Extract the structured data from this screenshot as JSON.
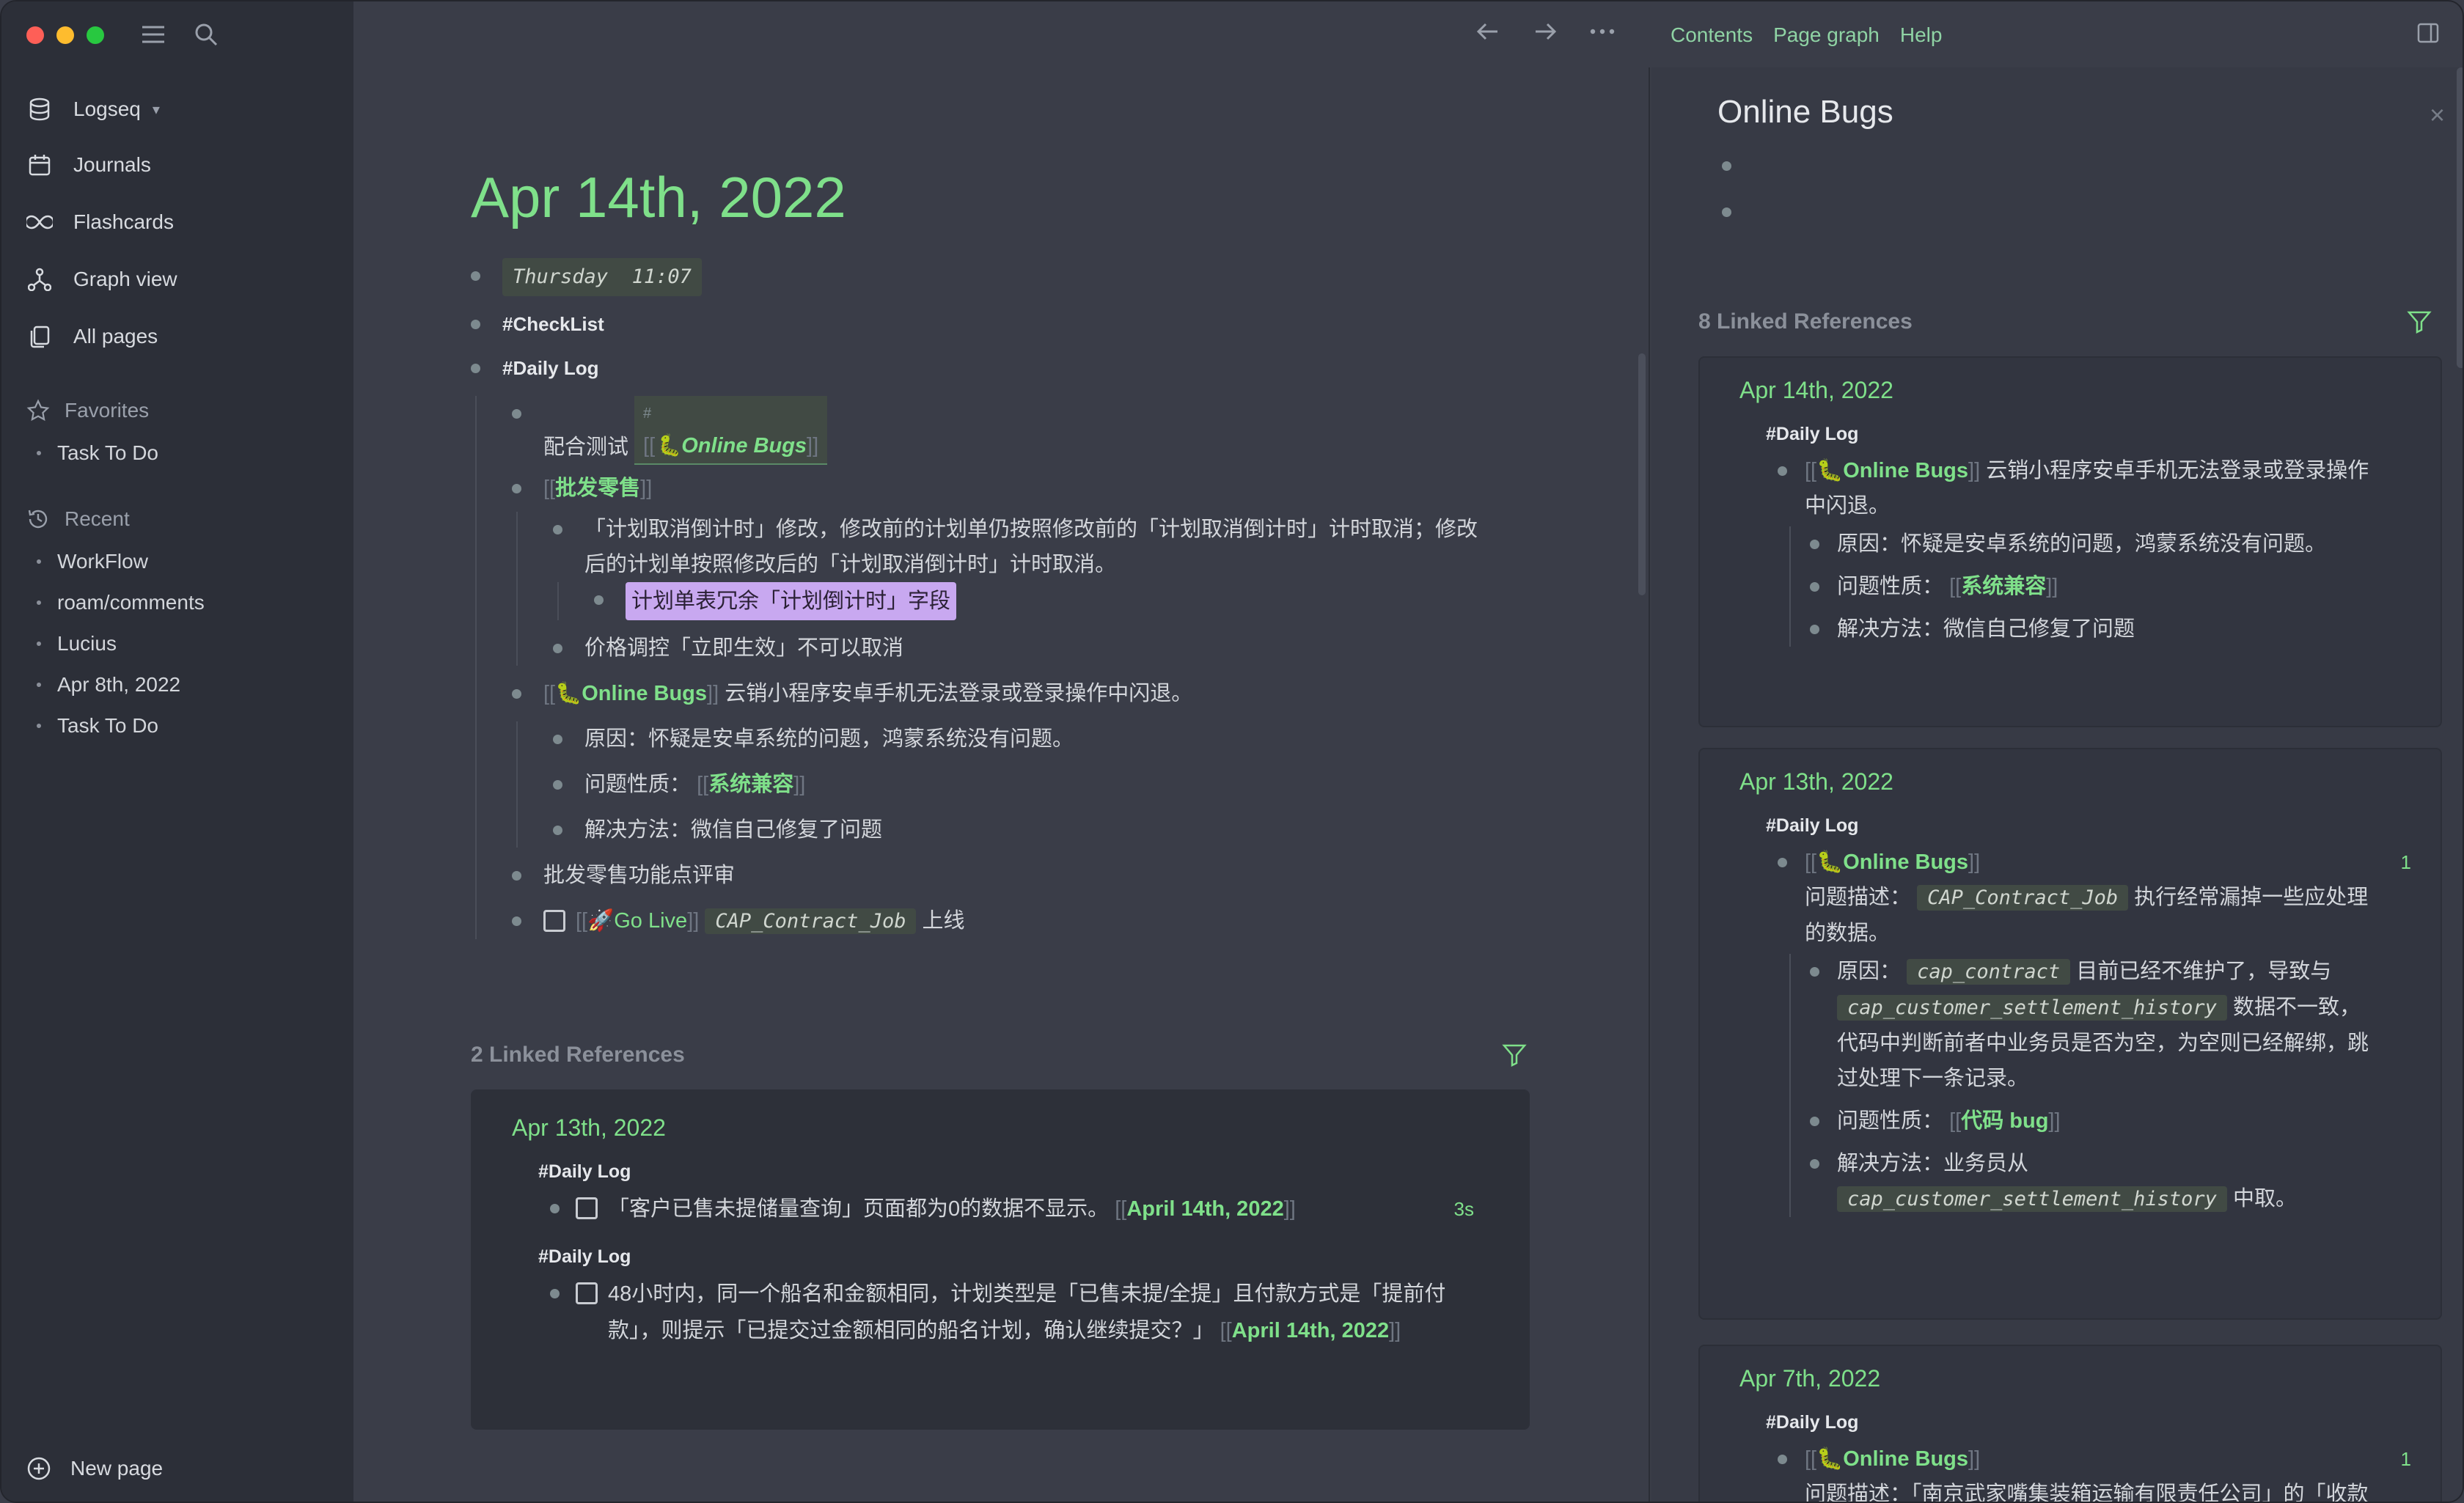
{
  "sidebar": {
    "workspace": "Logseq",
    "nav": [
      {
        "label": "Journals",
        "icon": "calendar-icon"
      },
      {
        "label": "Flashcards",
        "icon": "infinity-icon"
      },
      {
        "label": "Graph view",
        "icon": "graph-icon"
      },
      {
        "label": "All pages",
        "icon": "pages-icon"
      }
    ],
    "favorites_label": "Favorites",
    "favorites": [
      "Task To Do"
    ],
    "recent_label": "Recent",
    "recent": [
      "WorkFlow",
      "roam/comments",
      "Lucius",
      "Apr 8th, 2022",
      "Task To Do"
    ],
    "new_page": "New page"
  },
  "header": {
    "links": [
      "Contents",
      "Page graph",
      "Help"
    ]
  },
  "page": {
    "title": "Apr 14th, 2022",
    "b1_day": "Thursday",
    "b1_time": "11:07",
    "tag_checklist": "#CheckList",
    "tag_dailylog": "#Daily Log",
    "test_label": "配合测试",
    "hash": "#",
    "online_bugs": "🐛Online Bugs",
    "pifa": "批发零售",
    "plan_text": "「计划取消倒计时」修改，修改前的计划单仍按照修改前的「计划取消倒计时」计时取消；修改后的计划单按照修改后的「计划取消倒计时」计时取消。",
    "plan_highlight": "计划单表冗余「计划倒计时」字段",
    "price_text": "价格调控「立即生效」不可以取消",
    "bug_text": "云销小程序安卓手机无法登录或登录操作中闪退。",
    "reason": "原因：怀疑是安卓系统的问题，鸿蒙系统没有问题。",
    "nature_label": "问题性质：",
    "nature_ref": "系统兼容",
    "solution": "解决方法：微信自己修复了问题",
    "review": "批发零售功能点评审",
    "golive_ref": "🚀Go Live",
    "golive_code": "CAP_Contract_Job",
    "golive_suffix": "上线"
  },
  "linked": {
    "heading": "2 Linked References",
    "card_date": "Apr 13th, 2022",
    "tag": "#Daily Log",
    "item1": "「客户已售未提储量查询」页面都为0的数据不显示。",
    "item1_ref": "April 14th, 2022",
    "item1_time": "3s",
    "item2": "48小时内，同一个船名和金额相同，计划类型是「已售未提/全提」且付款方式是「提前付款」，则提示「已提交过金额相同的船名计划，确认继续提交？」",
    "item2_ref1": "April",
    "item2_ref2": "14th, 2022"
  },
  "right": {
    "title": "Online Bugs",
    "linked_heading": "8 Linked References",
    "c1_date": "Apr 14th, 2022",
    "c1_tag": "#Daily Log",
    "c1_ref": "🐛Online Bugs",
    "c1_text": "云销小程序安卓手机无法登录或登录操作中闪退。",
    "c1_reason": "原因：怀疑是安卓系统的问题，鸿蒙系统没有问题。",
    "c1_nature_label": "问题性质：",
    "c1_nature_ref": "系统兼容",
    "c1_solution": "解决方法：微信自己修复了问题",
    "c2_date": "Apr 13th, 2022",
    "c2_tag": "#Daily Log",
    "c2_ref": "🐛Online Bugs",
    "c2_count": "1",
    "c2_desc_label": "问题描述：",
    "c2_desc_code": "CAP_Contract_Job",
    "c2_desc_text": "执行经常漏掉一些应处理的数据。",
    "c2_reason_label": "原因：",
    "c2_reason_code": "cap_contract",
    "c2_reason_text1": "目前已经不维护了，导致与",
    "c2_reason_code2": "cap_customer_settlement_history",
    "c2_reason_text2": "数据不一致，代码中判断前者中业务员是否为空，为空则已经解绑，跳过处理下一条记录。",
    "c2_nature_label": "问题性质：",
    "c2_nature_ref": "代码 bug",
    "c2_solution_label": "解决方法：业务员从",
    "c2_solution_code": "cap_customer_settlement_history",
    "c2_solution_suffix": "中取。",
    "c3_date": "Apr 7th, 2022",
    "c3_tag": "#Daily Log",
    "c3_ref": "🐛Online Bugs",
    "c3_count": "1",
    "c3_desc": "问题描述：「南京武家嘴集装箱运输有限责任公司」的「收款超期」异常。"
  }
}
